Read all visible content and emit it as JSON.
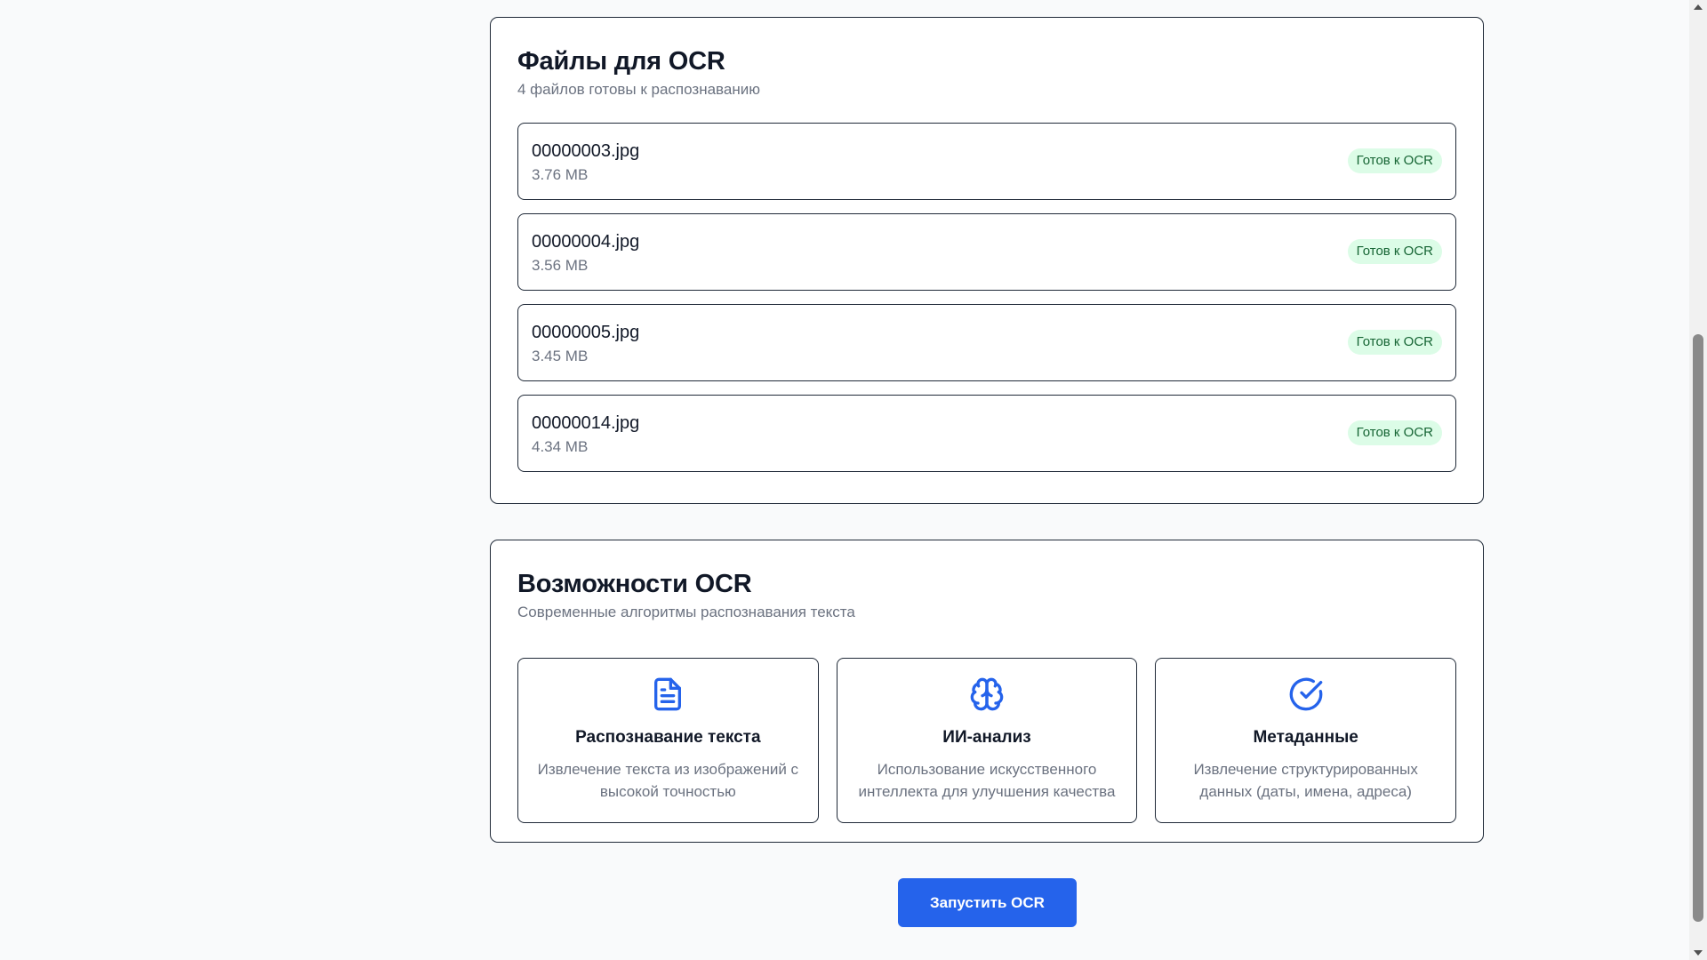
{
  "files_card": {
    "title": "Файлы для OCR",
    "subtitle": "4 файлов готовы к распознаванию",
    "files": [
      {
        "name": "00000003.jpg",
        "size": "3.76 MB",
        "status": "Готов к OCR"
      },
      {
        "name": "00000004.jpg",
        "size": "3.56 MB",
        "status": "Готов к OCR"
      },
      {
        "name": "00000005.jpg",
        "size": "3.45 MB",
        "status": "Готов к OCR"
      },
      {
        "name": "00000014.jpg",
        "size": "4.34 MB",
        "status": "Готов к OCR"
      }
    ]
  },
  "features_card": {
    "title": "Возможности OCR",
    "subtitle": "Современные алгоритмы распознавания текста",
    "features": [
      {
        "icon": "file-text-icon",
        "title": "Распознавание текста",
        "description": "Извлечение текста из изображений с высокой точностью"
      },
      {
        "icon": "brain-icon",
        "title": "ИИ-анализ",
        "description": "Использование искусственного интеллекта для улучшения качества"
      },
      {
        "icon": "check-circle-icon",
        "title": "Метаданные",
        "description": "Извлечение структурированных данных (даты, имена, адреса)"
      }
    ]
  },
  "actions": {
    "run_label": "Запустить OCR"
  },
  "colors": {
    "accent": "#2563eb",
    "badge_bg": "#dcfce7",
    "badge_text": "#166534",
    "muted_text": "#6b7280"
  }
}
